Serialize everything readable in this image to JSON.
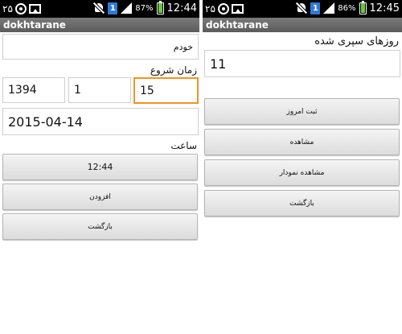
{
  "colors": {
    "status_bar": "#000000",
    "title_bar": "#6a6a6a",
    "focus": "#f0941f",
    "sim": "#2f7ad6",
    "battery": "#6cc644"
  },
  "left": {
    "status": {
      "notif_count": "۲۵",
      "battery_pct": "87%",
      "battery_level": 0.87,
      "time": "12:44",
      "sim": "1",
      "icons": [
        "circle-notification-icon",
        "photo-notification-icon",
        "mute-icon",
        "sim-icon",
        "signal-icon",
        "battery-icon"
      ]
    },
    "app_title": "dokhtarane",
    "name_value": "خودم",
    "start_time_label": "زمان شروع",
    "year_value": "1394",
    "month_value": "1",
    "day_value": "15",
    "date_value": "2015-04-14",
    "hour_label": "ساعت",
    "time_button": "12:44",
    "add_button": "افزودن",
    "back_button": "بازگشت"
  },
  "right": {
    "status": {
      "notif_count": "۲۵",
      "battery_pct": "86%",
      "battery_level": 0.86,
      "time": "12:45",
      "sim": "1"
    },
    "app_title": "dokhtarane",
    "elapsed_label": "روزهای سپری شده",
    "elapsed_value": "11",
    "record_today_button": "ثبت امروز",
    "view_button": "مشاهده",
    "view_chart_button": "مشاهده نمودار",
    "back_button": "بازگشت"
  }
}
